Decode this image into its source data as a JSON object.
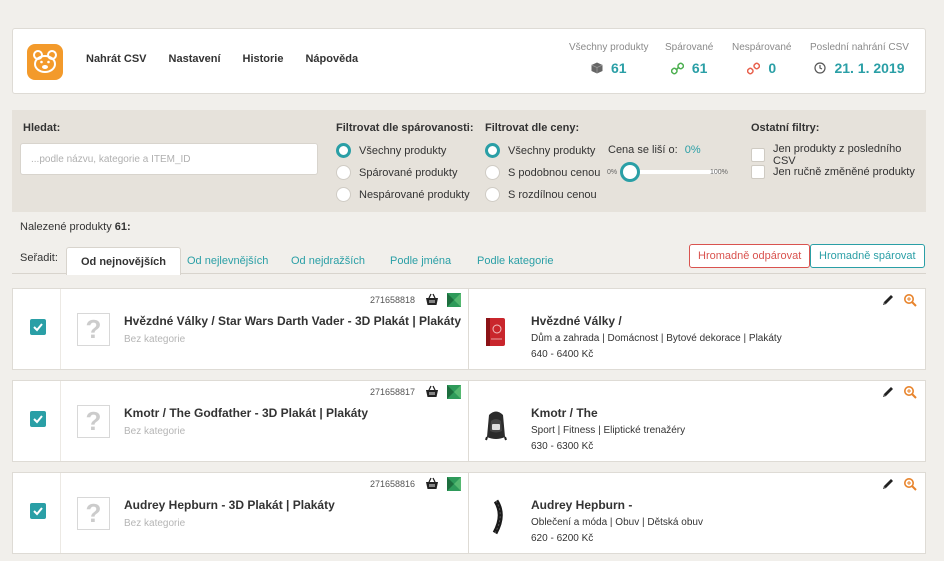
{
  "header": {
    "nav": [
      "Nahrát CSV",
      "Nastavení",
      "Historie",
      "Nápověda"
    ],
    "stats": {
      "all": {
        "label": "Všechny produkty",
        "value": "61"
      },
      "paired": {
        "label": "Spárované",
        "value": "61"
      },
      "unpaired": {
        "label": "Nespárované",
        "value": "0"
      },
      "last_upload": {
        "label": "Poslední nahrání CSV",
        "value": "21. 1. 2019"
      }
    }
  },
  "filters": {
    "search_label": "Hledat:",
    "search_placeholder": "...podle názvu, kategorie a ITEM_ID",
    "pairing_label": "Filtrovat dle spárovanosti:",
    "pairing_options": [
      "Všechny produkty",
      "Spárované produkty",
      "Nespárované produkty"
    ],
    "price_label": "Filtrovat dle ceny:",
    "price_options": [
      "Všechny produkty",
      "S podobnou cenou",
      "S rozdílnou cenou"
    ],
    "price_diff_label": "Cena se liší o:",
    "price_diff_value": "0%",
    "slider_min": "0%",
    "slider_max": "100%",
    "other_label": "Ostatní filtry:",
    "other_options": [
      "Jen produkty z posledního CSV",
      "Jen ručně změněné produkty"
    ]
  },
  "results": {
    "found_label": "Nalezené produkty",
    "found_count": "61:",
    "sort_label": "Seřadit:",
    "sort_tabs": [
      "Od nejnovějších",
      "Od nejlevnějších",
      "Od nejdražších",
      "Podle jména",
      "Podle kategorie"
    ],
    "bulk_unpair": "Hromadně odpárovat",
    "bulk_pair": "Hromadně spárovat"
  },
  "products": [
    {
      "id": "271658818",
      "name": "Hvězdné Války / Star Wars Darth Vader - 3D Plakát | Plakáty",
      "category": "Bez kategorie",
      "match_name": "Hvězdné Války /",
      "match_category": "Dům a zahrada | Domácnost | Bytové dekorace | Plakáty",
      "match_price": "640 - 6400 Kč",
      "thumb": "red-book"
    },
    {
      "id": "271658817",
      "name": "Kmotr / The Godfather - 3D Plakát | Plakáty",
      "category": "Bez kategorie",
      "match_name": "Kmotr / The",
      "match_category": "Sport | Fitness | Eliptické trenažéry",
      "match_price": "630 - 6300 Kč",
      "thumb": "backpack"
    },
    {
      "id": "271658816",
      "name": "Audrey Hepburn - 3D Plakát | Plakáty",
      "category": "Bez kategorie",
      "match_name": "Audrey Hepburn -",
      "match_category": "Oblečení a móda | Obuv | Dětská obuv",
      "match_price": "620 - 6200 Kč",
      "thumb": "tire"
    }
  ],
  "colors": {
    "accent": "#2a9fa6",
    "logo": "#f39a2b",
    "danger": "#d9534f",
    "pair_icon": "#4caf50",
    "unpair_icon": "#e8604c"
  }
}
